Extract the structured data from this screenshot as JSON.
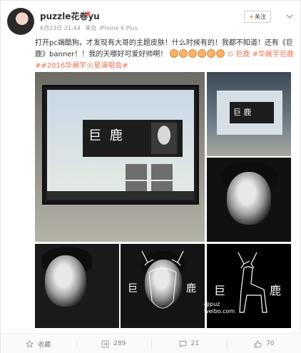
{
  "user": {
    "name": "puzzle花卷yu",
    "time": "6月23日 21:44",
    "source_prefix": "来自",
    "source": "iPhone 6 Plus"
  },
  "follow_button": {
    "label": "关注",
    "plus": "+"
  },
  "post": {
    "text_part1": "打开pc端酷狗，才发现有大哥的主题皮肤！什么时候有的！我都不知道！还有《巨鹿》banner！！我的天哪好可爱好帅啊！",
    "link_label": "巨鹿",
    "tags": "#华晨宇巨鹿##2016华晨宇火星演唱会#"
  },
  "images": {
    "banner_title": "巨 鹿",
    "watermark_handle": "@puz",
    "watermark_site": "weibo.com",
    "deer_left_char": "巨",
    "deer_right_char": "鹿"
  },
  "footer": {
    "favorite_label": "收藏",
    "repost_count": "289",
    "comment_count": "21",
    "like_count": "70"
  },
  "colors": {
    "accent": "#eb7350",
    "follow_plus": "#ff8200",
    "badge": "#ff4a4a"
  },
  "icons": [
    "vip-heart-icon",
    "more-icon",
    "link-icon",
    "favorite-icon",
    "repost-icon",
    "comment-icon",
    "like-icon"
  ]
}
